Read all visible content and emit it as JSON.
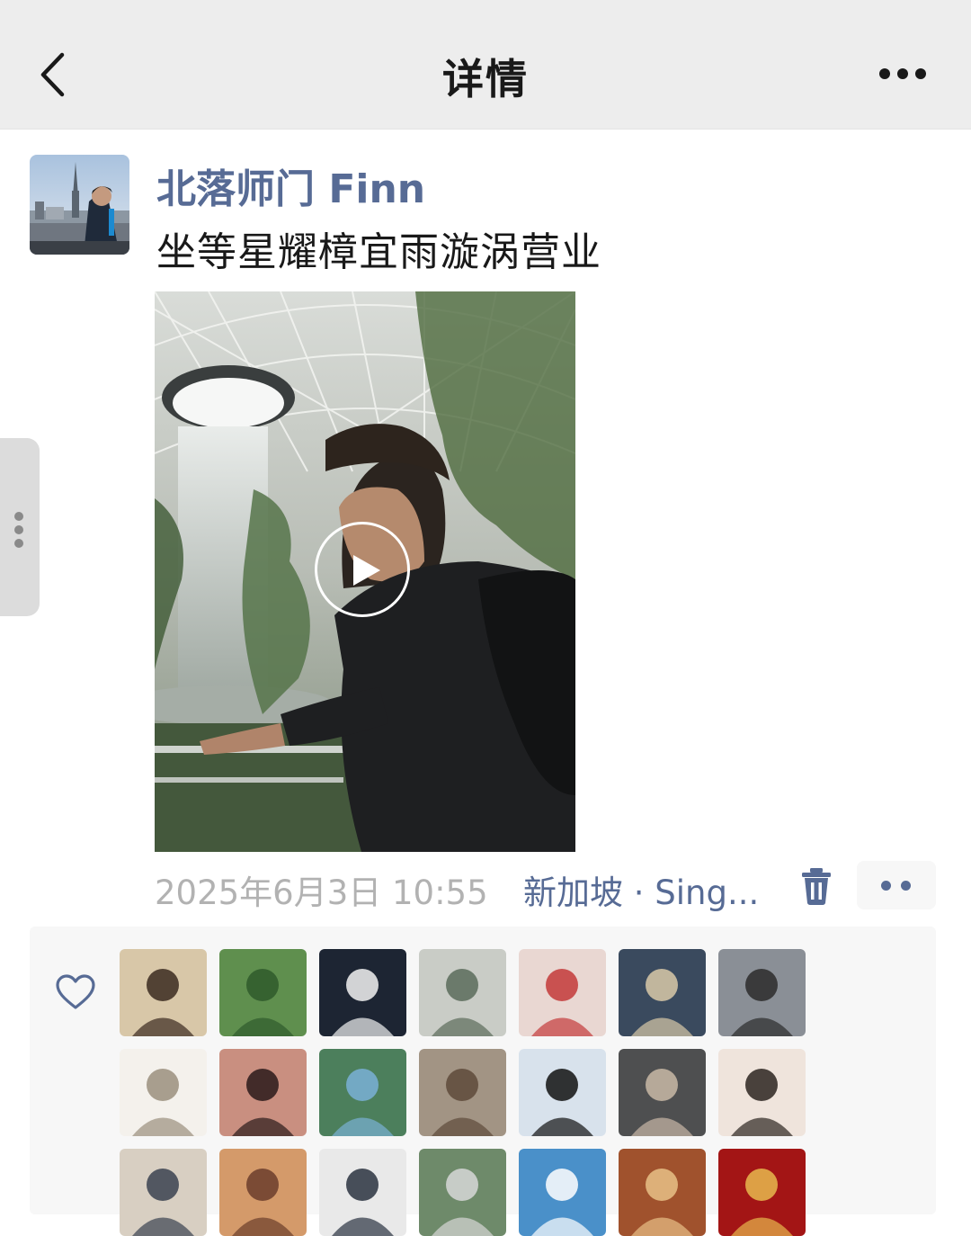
{
  "header": {
    "title": "详情"
  },
  "post": {
    "author": "北落师门 Finn",
    "text": "坐等星耀樟宜雨漩涡营业",
    "time": "2025年6月3日 10:55",
    "location": "新加坡 · Sing..."
  },
  "likes": {
    "avatars": [
      {
        "color": "#d8c7a8",
        "accent": "#3b2a20"
      },
      {
        "color": "#5f8f4e",
        "accent": "#2f5a2c"
      },
      {
        "color": "#1d2533",
        "accent": "#f2f2f2"
      },
      {
        "color": "#c9ccc6",
        "accent": "#5b6b5a"
      },
      {
        "color": "#e9d7d2",
        "accent": "#c33a3a"
      },
      {
        "color": "#3a4a5e",
        "accent": "#d9c9a8"
      },
      {
        "color": "#8a8f96",
        "accent": "#2b2b2b"
      },
      {
        "color": "#f4f1ec",
        "accent": "#9a8f7e"
      },
      {
        "color": "#c98f80",
        "accent": "#2a1a1a"
      },
      {
        "color": "#4c7f5c",
        "accent": "#7ab0d6"
      },
      {
        "color": "#a29484",
        "accent": "#5e4a3a"
      },
      {
        "color": "#d8e2ec",
        "accent": "#121212"
      },
      {
        "color": "#4e4f50",
        "accent": "#c9b8a6"
      },
      {
        "color": "#efe4dc",
        "accent": "#2c2520"
      },
      {
        "color": "#d8cfc2",
        "accent": "#3b4250"
      },
      {
        "color": "#d49a6a",
        "accent": "#6b3d2b"
      },
      {
        "color": "#e9e9e9",
        "accent": "#2a3240"
      },
      {
        "color": "#6e8a6a",
        "accent": "#d7d7d7"
      },
      {
        "color": "#4a90c9",
        "accent": "#ffffff"
      },
      {
        "color": "#a0522d",
        "accent": "#e8c187"
      },
      {
        "color": "#a31515",
        "accent": "#e7b84d"
      }
    ]
  },
  "colors": {
    "link": "#576b95",
    "meta": "#b2b2b2",
    "header_bg": "#ededed",
    "likes_bg": "#f7f7f7"
  }
}
